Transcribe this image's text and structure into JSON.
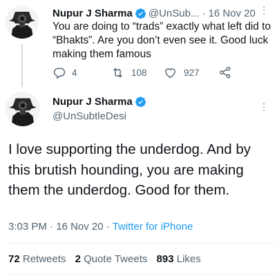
{
  "parent_tweet": {
    "name": "Nupur J Sharma",
    "handle": "@UnSub...",
    "separator": "·",
    "date": "16 Nov 20",
    "text": "You are doing to “trads” exactly what left did to “Bhakts”. Are you don’t even see it. Good luck making them famous",
    "actions": {
      "reply_count": "4",
      "retweet_count": "108",
      "like_count": "927"
    },
    "icons": [
      "verified-badge-icon",
      "more-dots-icon",
      "reply-icon",
      "retweet-icon",
      "like-icon",
      "share-icon"
    ]
  },
  "main_tweet": {
    "name": "Nupur J Sharma",
    "handle": "@UnSubtleDesi",
    "text": "I love supporting the underdog. And by this brutish hounding, you are making them the underdog. Good for them.",
    "time": "3:03 PM",
    "separator": "·",
    "date": "16 Nov 20",
    "separator2": "·",
    "source": "Twitter for iPhone",
    "stats": {
      "retweets_count": "72",
      "retweets_label": "Retweets",
      "quotes_count": "2",
      "quotes_label": "Quote Tweets",
      "likes_count": "893",
      "likes_label": "Likes"
    }
  },
  "colors": {
    "accent": "#1d9bf0",
    "text_primary": "#0f1419",
    "text_secondary": "#536471",
    "divider": "#eff3f4",
    "thread_line": "#cfd9de"
  }
}
